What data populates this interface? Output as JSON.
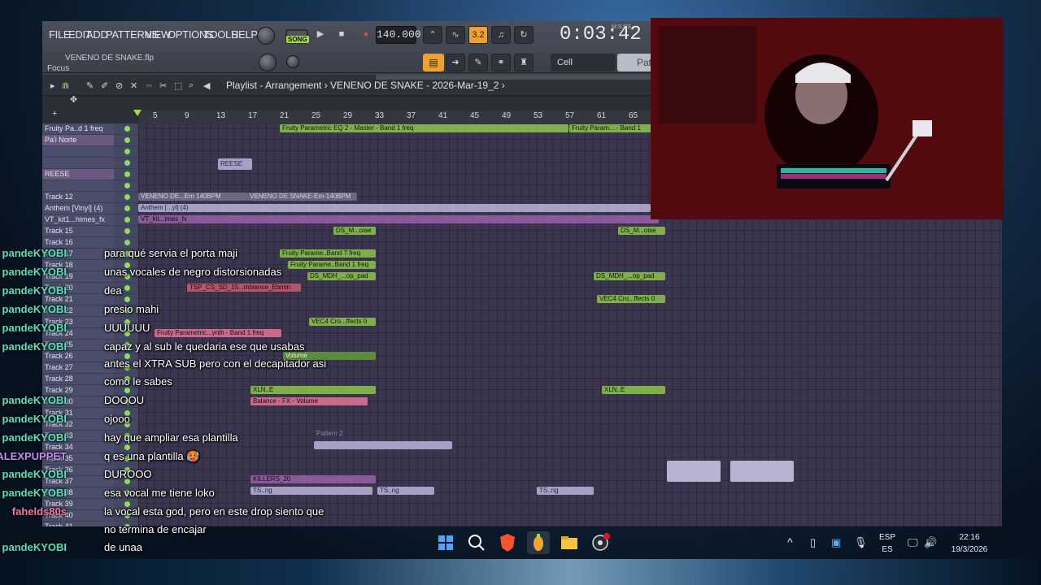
{
  "fl_studio": {
    "menu": [
      "FILE",
      "EDIT",
      "ADD",
      "PATTERNS",
      "VIEW",
      "OPTIONS",
      "TOOLS",
      "HELP"
    ],
    "file_name": "VENENO DE SNAKE.flp",
    "hint": "Focus",
    "song_label": "SONG",
    "tempo": "140.000",
    "time": "0:03:42",
    "time_label": "M:S:CS",
    "snap": "Cell",
    "pattern": "Patt",
    "playlist_title": "Playlist - Arrangement › VENENO DE SNAKE - 2026-Mar-19_2 ›",
    "ruler": [
      "5",
      "9",
      "13",
      "17",
      "21",
      "25",
      "29",
      "33",
      "37",
      "41",
      "45",
      "49",
      "53",
      "57",
      "61",
      "65"
    ],
    "tracks": [
      {
        "name": "Fruity Pa..d 1 freq"
      },
      {
        "name": "Pa'i Norte"
      },
      {
        "name": ""
      },
      {
        "name": ""
      },
      {
        "name": "REESE"
      },
      {
        "name": ""
      },
      {
        "name": "Track 12"
      },
      {
        "name": "Anthem [Vinyl] (4)"
      },
      {
        "name": "VT_kit1...himes_fx"
      },
      {
        "name": "Track 15"
      },
      {
        "name": "Track 16"
      },
      {
        "name": "Track 17"
      },
      {
        "name": "Track 18"
      },
      {
        "name": "Track 19"
      },
      {
        "name": "Track 20"
      },
      {
        "name": "Track 21"
      },
      {
        "name": "Track 22"
      },
      {
        "name": "Track 23"
      },
      {
        "name": "Track 24"
      },
      {
        "name": "Track 25"
      },
      {
        "name": "Track 26"
      },
      {
        "name": "Track 27"
      },
      {
        "name": "Track 28"
      },
      {
        "name": "Track 29"
      },
      {
        "name": "Track 30"
      },
      {
        "name": "Track 31"
      },
      {
        "name": "Track 32"
      },
      {
        "name": "Track 33"
      },
      {
        "name": "Track 34"
      },
      {
        "name": "Track 35"
      },
      {
        "name": "Track 36"
      },
      {
        "name": "Track 37"
      },
      {
        "name": "Track 38"
      },
      {
        "name": "Track 39"
      },
      {
        "name": "Track 40"
      },
      {
        "name": "Track 41"
      }
    ],
    "clips": {
      "eq_master": "Fruity Parametric EQ 2 - Master - Band 1 freq",
      "eq_right": "Fruity Param... - Band 1",
      "reese": "REESE",
      "veneno1": "VENENO DE...Em 140BPM",
      "veneno2": "VENENO DE SNAKE-Em-140BPM",
      "anthem": "Anthem [...yl] (4)",
      "vt_kit": "VT_kit...imes_fx",
      "ds_m": "DS_M...oise",
      "band7": "Fruity Parame..Band 7 freq",
      "band1": "Fruity Parame..Band 1 freq",
      "ds_mdh": "DS_MDH_...op_pad",
      "tsp": "TSP_CS_SD_15...mbiance_Ebmin",
      "vec4": "VEC4 Cro...ffects 0",
      "synth": "Fruity Parametric...ynth - Band 1 freq",
      "volume": "Volume",
      "balance": "Balance - FX - Volume",
      "xln": "XLN..E",
      "pattern2": "Pattern 2",
      "killers": "KILLERS_20",
      "ts_ng": "TS..ng"
    }
  },
  "chat": [
    {
      "user": "pandeKYOBI",
      "color": "teal",
      "msg": "para qué servia el porta maji"
    },
    {
      "user": "pandeKYOBI",
      "color": "teal",
      "msg": "unas vocales de negro distorsionadas"
    },
    {
      "user": "pandeKYOBI",
      "color": "teal",
      "msg": "dea"
    },
    {
      "user": "pandeKYOBI",
      "color": "teal",
      "msg": "presio mahi"
    },
    {
      "user": "pandeKYOBI",
      "color": "teal",
      "msg": "UUUUUU"
    },
    {
      "user": "pandeKYOBI",
      "color": "teal",
      "msg": "capaz y al sub le quedaria ese que usabas"
    },
    {
      "user": "",
      "color": "teal",
      "msg": "antes el XTRA SUB pero con el decapitador asi"
    },
    {
      "user": "",
      "color": "teal",
      "msg": "como le sabes"
    },
    {
      "user": "pandeKYOBI",
      "color": "teal",
      "msg": "DOOOU"
    },
    {
      "user": "pandeKYOBI",
      "color": "teal",
      "msg": "ojooo"
    },
    {
      "user": "pandeKYOBI",
      "color": "teal",
      "msg": "hay que ampliar esa plantilla"
    },
    {
      "user": "ALEXPUPPET",
      "color": "purple",
      "msg": "q es una plantilla 🥵"
    },
    {
      "user": "pandeKYOBI",
      "color": "teal",
      "msg": "DUROOO"
    },
    {
      "user": "pandeKYOBI",
      "color": "teal",
      "msg": "esa vocal me tiene loko"
    },
    {
      "user": "fahelds80s",
      "color": "pink",
      "msg": "la vocal esta god, pero en este drop siento que"
    },
    {
      "user": "",
      "color": "teal",
      "msg": "no termina de encajar"
    },
    {
      "user": "pandeKYOBI",
      "color": "teal",
      "msg": "de unaa"
    }
  ],
  "tray": {
    "lang_top": "ESP",
    "lang_bottom": "ES",
    "clock_time": "22:16",
    "clock_date": "19/3/2026"
  },
  "colors": {
    "chat_user_teal": "#54e3c0",
    "chat_user_purple": "#c58cf6",
    "chat_user_pink": "#f07ca0",
    "fl_accent_orange": "#f0a031",
    "fl_accent_green": "#9fdc3c"
  }
}
